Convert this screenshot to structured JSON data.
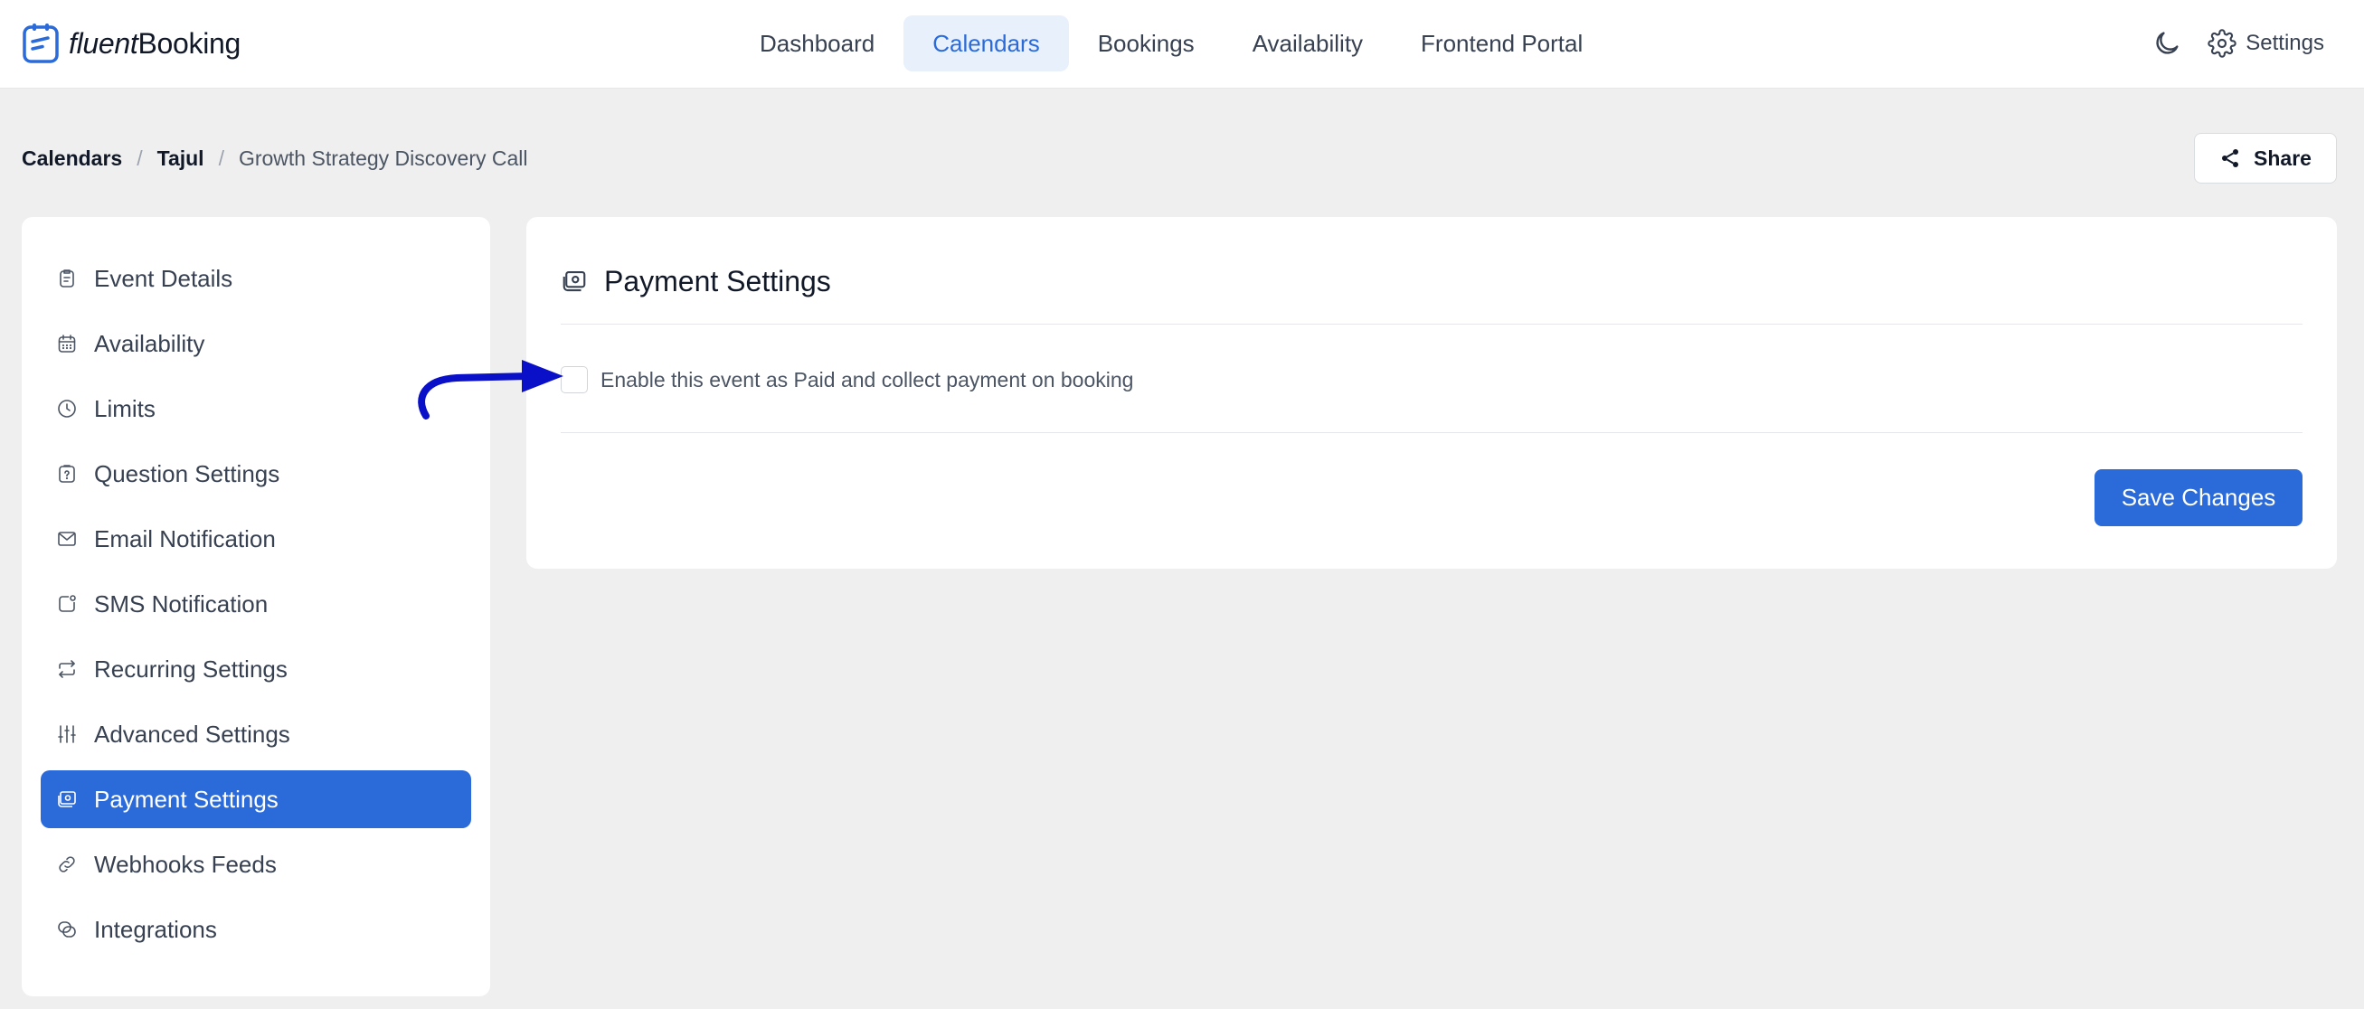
{
  "app": {
    "logo_light": "fluent",
    "logo_bold": "Booking"
  },
  "nav": {
    "items": [
      {
        "label": "Dashboard",
        "active": false
      },
      {
        "label": "Calendars",
        "active": true
      },
      {
        "label": "Bookings",
        "active": false
      },
      {
        "label": "Availability",
        "active": false
      },
      {
        "label": "Frontend Portal",
        "active": false
      }
    ],
    "settings_label": "Settings",
    "theme_icon": "moon-icon"
  },
  "breadcrumb": {
    "items": [
      "Calendars",
      "Tajul",
      "Growth Strategy Discovery Call"
    ],
    "separator": "/"
  },
  "share": {
    "label": "Share"
  },
  "sidebar": {
    "items": [
      {
        "label": "Event Details",
        "icon": "clipboard-icon"
      },
      {
        "label": "Availability",
        "icon": "calendar-icon"
      },
      {
        "label": "Limits",
        "icon": "clock-icon"
      },
      {
        "label": "Question Settings",
        "icon": "question-icon"
      },
      {
        "label": "Email Notification",
        "icon": "mail-icon"
      },
      {
        "label": "SMS Notification",
        "icon": "sms-icon"
      },
      {
        "label": "Recurring Settings",
        "icon": "repeat-icon"
      },
      {
        "label": "Advanced Settings",
        "icon": "sliders-icon"
      },
      {
        "label": "Payment Settings",
        "icon": "payment-icon",
        "active": true
      },
      {
        "label": "Webhooks Feeds",
        "icon": "link-icon"
      },
      {
        "label": "Integrations",
        "icon": "integrations-icon"
      }
    ]
  },
  "main": {
    "title": "Payment Settings",
    "enable_paid_label": "Enable this event as Paid and collect payment on booking",
    "enable_paid_checked": false,
    "save_label": "Save Changes"
  },
  "colors": {
    "accent": "#2b6ad9",
    "page_bg": "#efefef",
    "arrow": "#0a0fc8"
  }
}
